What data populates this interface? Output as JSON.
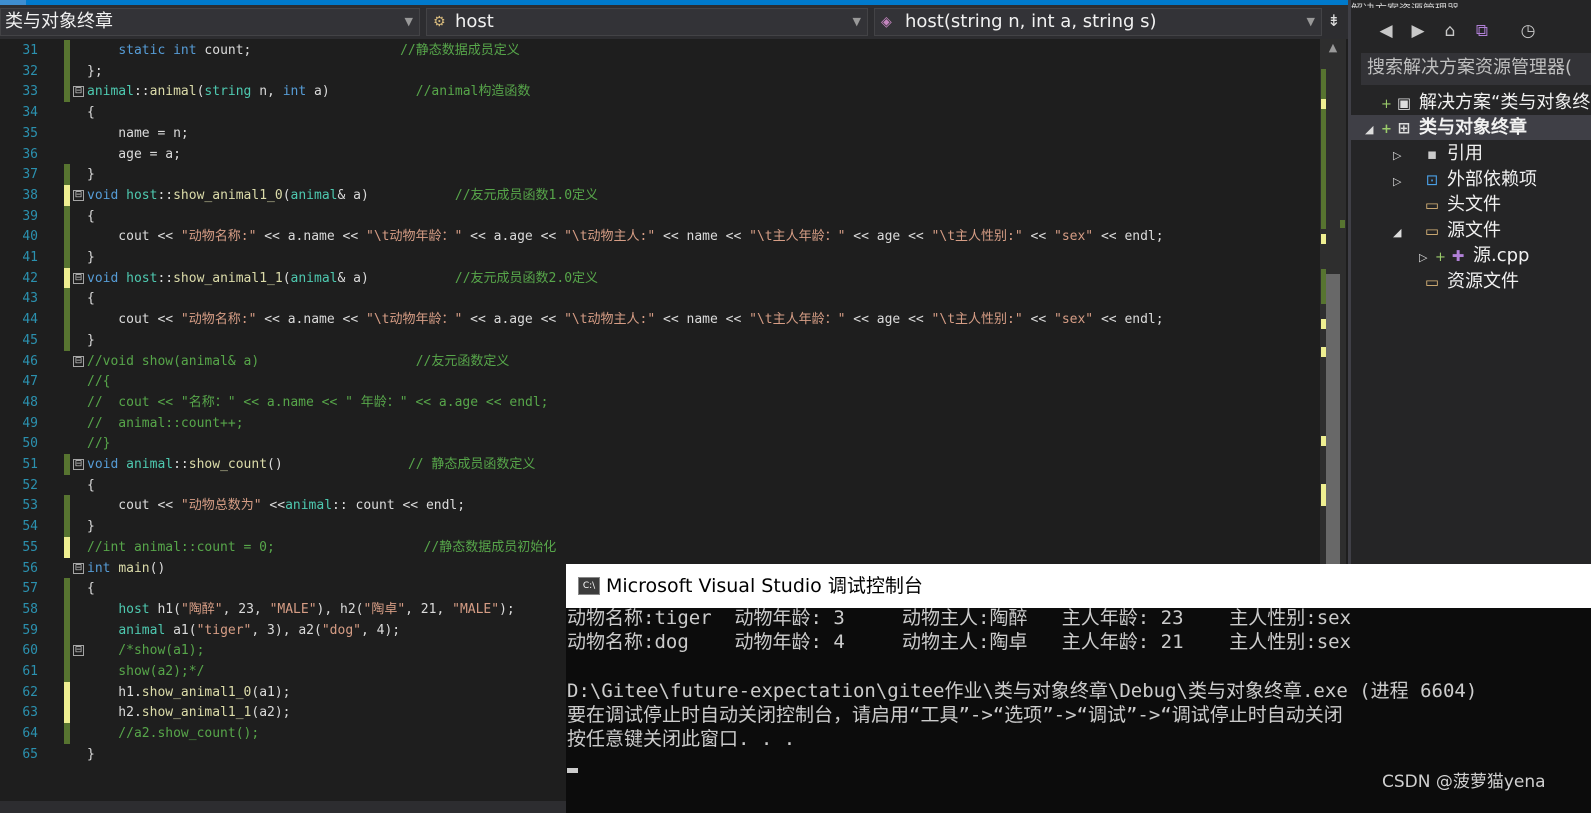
{
  "navigation_bar": {
    "project_dropdown": "类与对象终章",
    "class_dropdown": "host",
    "member_dropdown": "host(string n, int a, string s)"
  },
  "icons": {
    "class_icon": "class-icon",
    "method_icon": "method-icon",
    "split_icon": "split-editor-icon"
  },
  "editor": {
    "lines": [
      {
        "n": "31",
        "c": "g",
        "fold": "",
        "segs": [
          {
            "t": "    ",
            "k": ""
          },
          {
            "t": "static",
            "k": "kw"
          },
          {
            "t": " ",
            "k": ""
          },
          {
            "t": "int",
            "k": "kw"
          },
          {
            "t": " count;                   ",
            "k": ""
          },
          {
            "t": "//静态数据成员定义",
            "k": "cm"
          }
        ]
      },
      {
        "n": "32",
        "c": "g",
        "fold": "",
        "segs": [
          {
            "t": "};",
            "k": ""
          }
        ]
      },
      {
        "n": "33",
        "c": "g",
        "fold": "⊟",
        "segs": [
          {
            "t": "animal",
            "k": "ty"
          },
          {
            "t": "::",
            "k": ""
          },
          {
            "t": "animal",
            "k": "fn"
          },
          {
            "t": "(",
            "k": ""
          },
          {
            "t": "string",
            "k": "ty"
          },
          {
            "t": " n, ",
            "k": "pr"
          },
          {
            "t": "int",
            "k": "kw"
          },
          {
            "t": " a)           ",
            "k": "pr"
          },
          {
            "t": "//animal构造函数",
            "k": "cm"
          }
        ]
      },
      {
        "n": "34",
        "c": "",
        "fold": "",
        "segs": [
          {
            "t": "{",
            "k": ""
          }
        ]
      },
      {
        "n": "35",
        "c": "",
        "fold": "",
        "segs": [
          {
            "t": "    name = n;",
            "k": ""
          }
        ]
      },
      {
        "n": "36",
        "c": "",
        "fold": "",
        "segs": [
          {
            "t": "    age = a;",
            "k": ""
          }
        ]
      },
      {
        "n": "37",
        "c": "g",
        "fold": "",
        "segs": [
          {
            "t": "}",
            "k": ""
          }
        ]
      },
      {
        "n": "38",
        "c": "y",
        "fold": "⊟",
        "segs": [
          {
            "t": "void",
            "k": "kw"
          },
          {
            "t": " ",
            "k": ""
          },
          {
            "t": "host",
            "k": "ty"
          },
          {
            "t": "::",
            "k": ""
          },
          {
            "t": "show_animal1_0",
            "k": "fn"
          },
          {
            "t": "(",
            "k": ""
          },
          {
            "t": "animal",
            "k": "ty"
          },
          {
            "t": "& a)           ",
            "k": "pr"
          },
          {
            "t": "//友元成员函数1.0定义",
            "k": "cm"
          }
        ]
      },
      {
        "n": "39",
        "c": "g",
        "fold": "",
        "segs": [
          {
            "t": "{",
            "k": ""
          }
        ]
      },
      {
        "n": "40",
        "c": "g",
        "fold": "",
        "segs": [
          {
            "t": "    cout << ",
            "k": ""
          },
          {
            "t": "\"动物名称:\"",
            "k": "st"
          },
          {
            "t": " << a.",
            "k": ""
          },
          {
            "t": "name",
            "k": "pr"
          },
          {
            "t": " << ",
            "k": ""
          },
          {
            "t": "\"\\t动物年龄：\"",
            "k": "st"
          },
          {
            "t": " << a.",
            "k": ""
          },
          {
            "t": "age",
            "k": "pr"
          },
          {
            "t": " << ",
            "k": ""
          },
          {
            "t": "\"\\t动物主人:\"",
            "k": "st"
          },
          {
            "t": " << name << ",
            "k": ""
          },
          {
            "t": "\"\\t主人年龄：\"",
            "k": "st"
          },
          {
            "t": " << age << ",
            "k": ""
          },
          {
            "t": "\"\\t主人性别:\"",
            "k": "st"
          },
          {
            "t": " << ",
            "k": ""
          },
          {
            "t": "\"sex\"",
            "k": "st"
          },
          {
            "t": " << endl;",
            "k": ""
          }
        ]
      },
      {
        "n": "41",
        "c": "g",
        "fold": "",
        "segs": [
          {
            "t": "}",
            "k": ""
          }
        ]
      },
      {
        "n": "42",
        "c": "y",
        "fold": "⊟",
        "segs": [
          {
            "t": "void",
            "k": "kw"
          },
          {
            "t": " ",
            "k": ""
          },
          {
            "t": "host",
            "k": "ty"
          },
          {
            "t": "::",
            "k": ""
          },
          {
            "t": "show_animal1_1",
            "k": "fn"
          },
          {
            "t": "(",
            "k": ""
          },
          {
            "t": "animal",
            "k": "ty"
          },
          {
            "t": "& a)           ",
            "k": "pr"
          },
          {
            "t": "//友元成员函数2.0定义",
            "k": "cm"
          }
        ]
      },
      {
        "n": "43",
        "c": "g",
        "fold": "",
        "segs": [
          {
            "t": "{",
            "k": ""
          }
        ]
      },
      {
        "n": "44",
        "c": "g",
        "fold": "",
        "segs": [
          {
            "t": "    cout << ",
            "k": ""
          },
          {
            "t": "\"动物名称:\"",
            "k": "st"
          },
          {
            "t": " << a.",
            "k": ""
          },
          {
            "t": "name",
            "k": "pr"
          },
          {
            "t": " << ",
            "k": ""
          },
          {
            "t": "\"\\t动物年龄：\"",
            "k": "st"
          },
          {
            "t": " << a.",
            "k": ""
          },
          {
            "t": "age",
            "k": "pr"
          },
          {
            "t": " << ",
            "k": ""
          },
          {
            "t": "\"\\t动物主人:\"",
            "k": "st"
          },
          {
            "t": " << name << ",
            "k": ""
          },
          {
            "t": "\"\\t主人年龄：\"",
            "k": "st"
          },
          {
            "t": " << age << ",
            "k": ""
          },
          {
            "t": "\"\\t主人性别:\"",
            "k": "st"
          },
          {
            "t": " << ",
            "k": ""
          },
          {
            "t": "\"sex\"",
            "k": "st"
          },
          {
            "t": " << endl;",
            "k": ""
          }
        ]
      },
      {
        "n": "45",
        "c": "g",
        "fold": "",
        "segs": [
          {
            "t": "}",
            "k": ""
          }
        ]
      },
      {
        "n": "46",
        "c": "",
        "fold": "⊟",
        "segs": [
          {
            "t": "//void show(animal& a)                    //友元函数定义",
            "k": "cm"
          }
        ]
      },
      {
        "n": "47",
        "c": "",
        "fold": "",
        "segs": [
          {
            "t": "//{",
            "k": "cm"
          }
        ]
      },
      {
        "n": "48",
        "c": "",
        "fold": "",
        "segs": [
          {
            "t": "//  cout << \"名称：\" << a.name << \" 年龄：\" << a.age << endl;",
            "k": "cm"
          }
        ]
      },
      {
        "n": "49",
        "c": "",
        "fold": "",
        "segs": [
          {
            "t": "//  animal::count++;",
            "k": "cm"
          }
        ]
      },
      {
        "n": "50",
        "c": "",
        "fold": "",
        "segs": [
          {
            "t": "//}",
            "k": "cm"
          }
        ]
      },
      {
        "n": "51",
        "c": "g",
        "fold": "⊟",
        "segs": [
          {
            "t": "void",
            "k": "kw"
          },
          {
            "t": " ",
            "k": ""
          },
          {
            "t": "animal",
            "k": "ty"
          },
          {
            "t": "::",
            "k": ""
          },
          {
            "t": "show_count",
            "k": "fn"
          },
          {
            "t": "()                ",
            "k": ""
          },
          {
            "t": "// 静态成员函数定义",
            "k": "cm"
          }
        ]
      },
      {
        "n": "52",
        "c": "",
        "fold": "",
        "segs": [
          {
            "t": "{",
            "k": ""
          }
        ]
      },
      {
        "n": "53",
        "c": "g",
        "fold": "",
        "segs": [
          {
            "t": "    cout << ",
            "k": ""
          },
          {
            "t": "\"动物总数为\"",
            "k": "st"
          },
          {
            "t": " <<",
            "k": ""
          },
          {
            "t": "animal",
            "k": "ty"
          },
          {
            "t": ":: count << endl;",
            "k": ""
          }
        ]
      },
      {
        "n": "54",
        "c": "g",
        "fold": "",
        "segs": [
          {
            "t": "}",
            "k": ""
          }
        ]
      },
      {
        "n": "55",
        "c": "y",
        "fold": "",
        "segs": [
          {
            "t": "//int animal::count = 0;                   //静态数据成员初始化",
            "k": "cm"
          }
        ]
      },
      {
        "n": "56",
        "c": "",
        "fold": "⊟",
        "segs": [
          {
            "t": "int",
            "k": "kw"
          },
          {
            "t": " ",
            "k": ""
          },
          {
            "t": "main",
            "k": "fn"
          },
          {
            "t": "()",
            "k": ""
          }
        ]
      },
      {
        "n": "57",
        "c": "g",
        "fold": "",
        "segs": [
          {
            "t": "{",
            "k": ""
          }
        ]
      },
      {
        "n": "58",
        "c": "g",
        "fold": "",
        "segs": [
          {
            "t": "    ",
            "k": ""
          },
          {
            "t": "host",
            "k": "ty"
          },
          {
            "t": " ",
            "k": ""
          },
          {
            "t": "h1",
            "k": "pr"
          },
          {
            "t": "(",
            "k": ""
          },
          {
            "t": "\"陶醉\"",
            "k": "st"
          },
          {
            "t": ", 23, ",
            "k": ""
          },
          {
            "t": "\"MALE\"",
            "k": "st"
          },
          {
            "t": "), ",
            "k": ""
          },
          {
            "t": "h2",
            "k": "pr"
          },
          {
            "t": "(",
            "k": ""
          },
          {
            "t": "\"陶卓\"",
            "k": "st"
          },
          {
            "t": ", 21, ",
            "k": ""
          },
          {
            "t": "\"MALE\"",
            "k": "st"
          },
          {
            "t": ");",
            "k": ""
          }
        ]
      },
      {
        "n": "59",
        "c": "g",
        "fold": "",
        "segs": [
          {
            "t": "    ",
            "k": ""
          },
          {
            "t": "animal",
            "k": "ty"
          },
          {
            "t": " ",
            "k": ""
          },
          {
            "t": "a1",
            "k": "pr"
          },
          {
            "t": "(",
            "k": ""
          },
          {
            "t": "\"tiger\"",
            "k": "st"
          },
          {
            "t": ", 3), ",
            "k": ""
          },
          {
            "t": "a2",
            "k": "pr"
          },
          {
            "t": "(",
            "k": ""
          },
          {
            "t": "\"dog\"",
            "k": "st"
          },
          {
            "t": ", 4);",
            "k": ""
          }
        ]
      },
      {
        "n": "60",
        "c": "g",
        "fold": "⊟",
        "segs": [
          {
            "t": "    /*show(a1);",
            "k": "cm"
          }
        ]
      },
      {
        "n": "61",
        "c": "g",
        "fold": "",
        "segs": [
          {
            "t": "    show(a2);*/",
            "k": "cm"
          }
        ]
      },
      {
        "n": "62",
        "c": "y",
        "fold": "",
        "segs": [
          {
            "t": "    h1.",
            "k": ""
          },
          {
            "t": "show_animal1_0",
            "k": "fn"
          },
          {
            "t": "(a1);",
            "k": ""
          }
        ]
      },
      {
        "n": "63",
        "c": "y",
        "fold": "",
        "segs": [
          {
            "t": "    h2.",
            "k": ""
          },
          {
            "t": "show_animal1_1",
            "k": "fn"
          },
          {
            "t": "(a2);",
            "k": ""
          }
        ]
      },
      {
        "n": "64",
        "c": "g",
        "fold": "",
        "segs": [
          {
            "t": "    //a2.show_count();",
            "k": "cm"
          }
        ]
      },
      {
        "n": "65",
        "c": "",
        "fold": "",
        "segs": [
          {
            "t": "}",
            "k": ""
          }
        ]
      }
    ]
  },
  "solution_explorer": {
    "top_label": "解决方案资源管理器",
    "search_placeholder": "搜索解决方案资源管理器(",
    "toolbar_icons": [
      "back-icon",
      "forward-icon",
      "home-icon",
      "vs-switch-icon",
      "history-icon"
    ],
    "items": [
      {
        "label": "解决方案“类与对象终",
        "icon": "solution-icon",
        "expander": "",
        "plus": "+"
      },
      {
        "label": "类与对象终章",
        "icon": "project-icon",
        "expander": "◢",
        "plus": "+"
      },
      {
        "label": "引用",
        "icon": "references-icon",
        "expander": "▷",
        "plus": ""
      },
      {
        "label": "外部依赖项",
        "icon": "external-deps-icon",
        "expander": "▷",
        "plus": ""
      },
      {
        "label": "头文件",
        "icon": "folder-icon",
        "expander": "",
        "plus": ""
      },
      {
        "label": "源文件",
        "icon": "folder-icon",
        "expander": "◢",
        "plus": ""
      },
      {
        "label": "源.cpp",
        "icon": "cpp-file-icon",
        "expander": "▷",
        "plus": "+"
      },
      {
        "label": "资源文件",
        "icon": "folder-icon",
        "expander": "",
        "plus": ""
      }
    ]
  },
  "console": {
    "title": "Microsoft Visual Studio 调试控制台",
    "icon_text": "C:\\",
    "lines": [
      "动物名称:tiger  动物年龄: 3     动物主人:陶醉   主人年龄: 23    主人性别:sex",
      "动物名称:dog    动物年龄: 4     动物主人:陶卓   主人年龄: 21    主人性别:sex",
      "",
      "D:\\Gitee\\future-expectation\\gitee作业\\类与对象终章\\Debug\\类与对象终章.exe (进程 6604)",
      "要在调试停止时自动关闭控制台，请启用“工具”->“选项”->“调试”->“调试停止时自动关闭",
      "按任意键关闭此窗口. . ."
    ]
  },
  "watermark": "CSDN @菠萝猫yena"
}
